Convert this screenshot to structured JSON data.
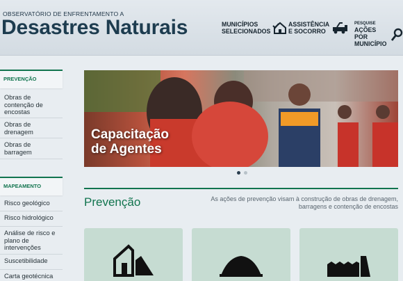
{
  "header": {
    "subtitle": "OBSERVATÓRIO DE ENFRENTAMENTO A",
    "title": "Desastres Naturais",
    "nav": [
      {
        "line1": "MUNICÍPIOS",
        "line2": "SELECIONADOS",
        "icon": "house-check-icon"
      },
      {
        "line1": "ASSISTÊNCIA",
        "line2": "E SOCORRO",
        "icon": "rescue-truck-icon"
      },
      {
        "small": "PESQUISE",
        "line1": "AÇÕES POR",
        "line2": "MUNICÍPIO",
        "icon": "search-icon"
      }
    ]
  },
  "sidebar": {
    "prevencao": {
      "heading": "PREVENÇÃO",
      "items": [
        "Obras de contenção de encostas",
        "Obras de drenagem",
        "Obras de barragem"
      ]
    },
    "mapeamento": {
      "heading": "MAPEAMENTO",
      "items": [
        "Risco geológico",
        "Risco hidrológico",
        "Análise de risco e plano de intervenções",
        "Suscetibilidade",
        "Carta geotécnica"
      ]
    }
  },
  "banner": {
    "caption_line1": "Capacitação",
    "caption_line2": "de Agentes",
    "active_slide": 1,
    "slide_count": 2
  },
  "section": {
    "title": "Prevenção",
    "description": "As ações de prevenção visam à construção de obras de drenagem, barragens e contenção de encostas"
  },
  "cards": [
    {
      "icon": "slope-containment-icon"
    },
    {
      "icon": "drainage-icon"
    },
    {
      "icon": "dam-icon"
    }
  ],
  "colors": {
    "accent": "#11744e",
    "title": "#1d3c4f",
    "card": "#c6dcd2"
  }
}
